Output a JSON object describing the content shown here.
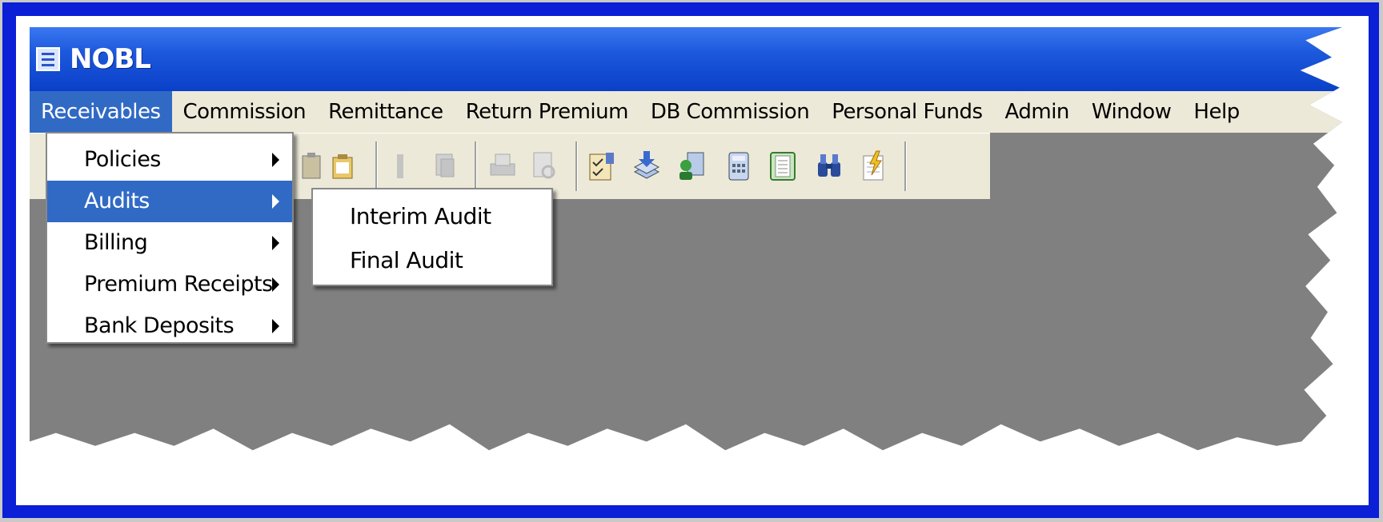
{
  "window": {
    "title": "NOBL"
  },
  "menubar": {
    "items": [
      {
        "label": "Receivables",
        "active": true
      },
      {
        "label": "Commission"
      },
      {
        "label": "Remittance"
      },
      {
        "label": "Return Premium"
      },
      {
        "label": "DB Commission"
      },
      {
        "label": "Personal Funds"
      },
      {
        "label": "Admin"
      },
      {
        "label": "Window"
      },
      {
        "label": "Help"
      }
    ]
  },
  "receivables_menu": {
    "items": [
      {
        "label": "Policies"
      },
      {
        "label": "Audits",
        "highlighted": true
      },
      {
        "label": "Billing"
      },
      {
        "label": "Premium Receipts"
      },
      {
        "label": "Bank Deposits"
      }
    ]
  },
  "audits_submenu": {
    "items": [
      {
        "label": "Interim Audit"
      },
      {
        "label": "Final Audit"
      }
    ]
  },
  "toolbar": {
    "icons": [
      "paste-icon",
      "clipboard-icon",
      "cut-icon",
      "copy-icon",
      "print-icon",
      "print-preview-icon",
      "audit-report-icon",
      "deposit-stack-icon",
      "user-report-icon",
      "calculator-icon",
      "document-list-icon",
      "binoculars-icon",
      "notes-icon"
    ]
  },
  "colors": {
    "title_bar": "#1c58dc",
    "menu_highlight": "#316ac5",
    "menu_bar": "#ece9d8",
    "workspace": "#808080",
    "frame_border": "#0a1fd6"
  }
}
